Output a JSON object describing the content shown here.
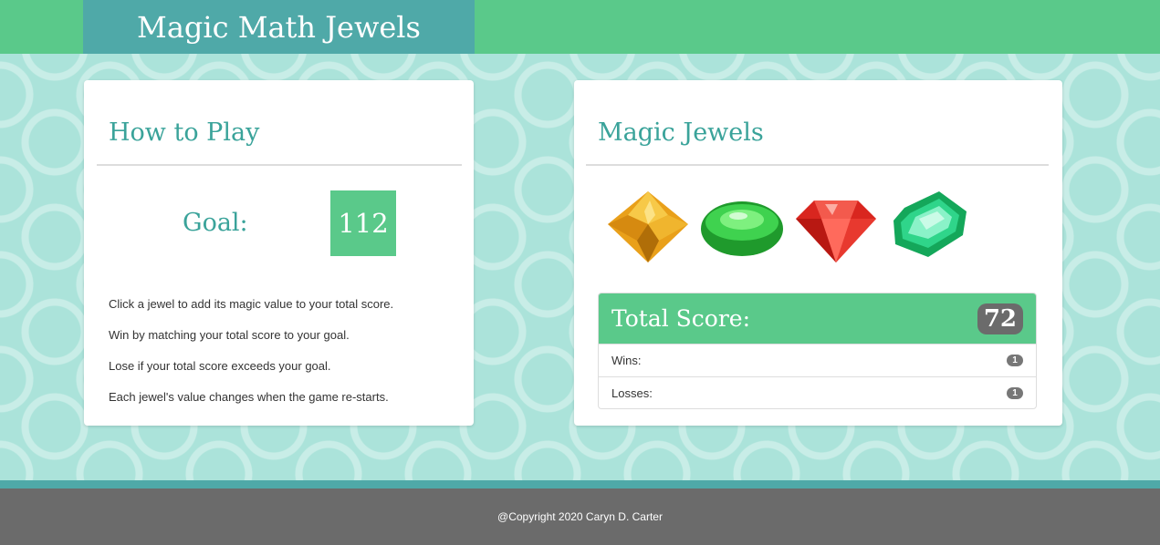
{
  "header": {
    "title": "Magic Math Jewels"
  },
  "how_to_play": {
    "title": "How to Play",
    "goal_label": "Goal:",
    "goal_value": "112",
    "rules": [
      "Click a jewel to add its magic value to your total score.",
      "Win by matching your total score to your goal.",
      "Lose if your total score exceeds your goal.",
      "Each jewel's value changes when the game re-starts."
    ]
  },
  "jewels_panel": {
    "title": "Magic Jewels",
    "jewels": [
      {
        "name": "yellow-diamond-icon",
        "color": "#f2a91b"
      },
      {
        "name": "green-oval-gem-icon",
        "color": "#2cbf3a"
      },
      {
        "name": "red-ruby-icon",
        "color": "#e8322b"
      },
      {
        "name": "emerald-icon",
        "color": "#29c27a"
      }
    ],
    "score_label": "Total Score:",
    "score_value": "72",
    "wins_label": "Wins:",
    "wins_value": "1",
    "losses_label": "Losses:",
    "losses_value": "1"
  },
  "footer": {
    "copyright": "@Copyright 2020 Caryn D. Carter"
  },
  "colors": {
    "header_green": "#5ac98a",
    "brand_teal": "#4fa9a8",
    "heading_teal": "#3aa39a",
    "footer_gray": "#6b6b6b"
  }
}
